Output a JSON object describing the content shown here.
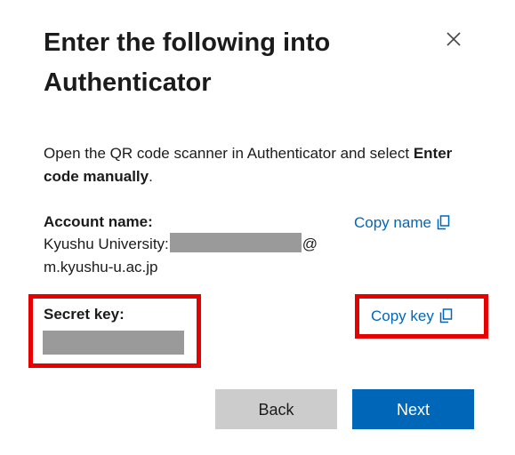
{
  "dialog": {
    "title_line1": "Enter the following into",
    "title_line2": "Authenticator",
    "close_icon": "close-icon"
  },
  "instructions": {
    "text_before": "Open the QR code scanner in Authenticator and select ",
    "text_bold": "Enter code manually",
    "text_after": "."
  },
  "account": {
    "label": "Account name:",
    "value_prefix": "Kyushu University:",
    "value_at": "@",
    "value_domain": "m.kyushu-u.ac.jp",
    "copy_label": "Copy name",
    "copy_icon": "copy-icon"
  },
  "secret": {
    "label": "Secret key:",
    "copy_label": "Copy key",
    "copy_icon": "copy-icon"
  },
  "buttons": {
    "back": "Back",
    "next": "Next"
  },
  "colors": {
    "link": "#0067b8",
    "primary_button": "#0067b8",
    "secondary_button": "#cccccc",
    "highlight": "#e60000",
    "redaction": "#9a9a9a"
  }
}
